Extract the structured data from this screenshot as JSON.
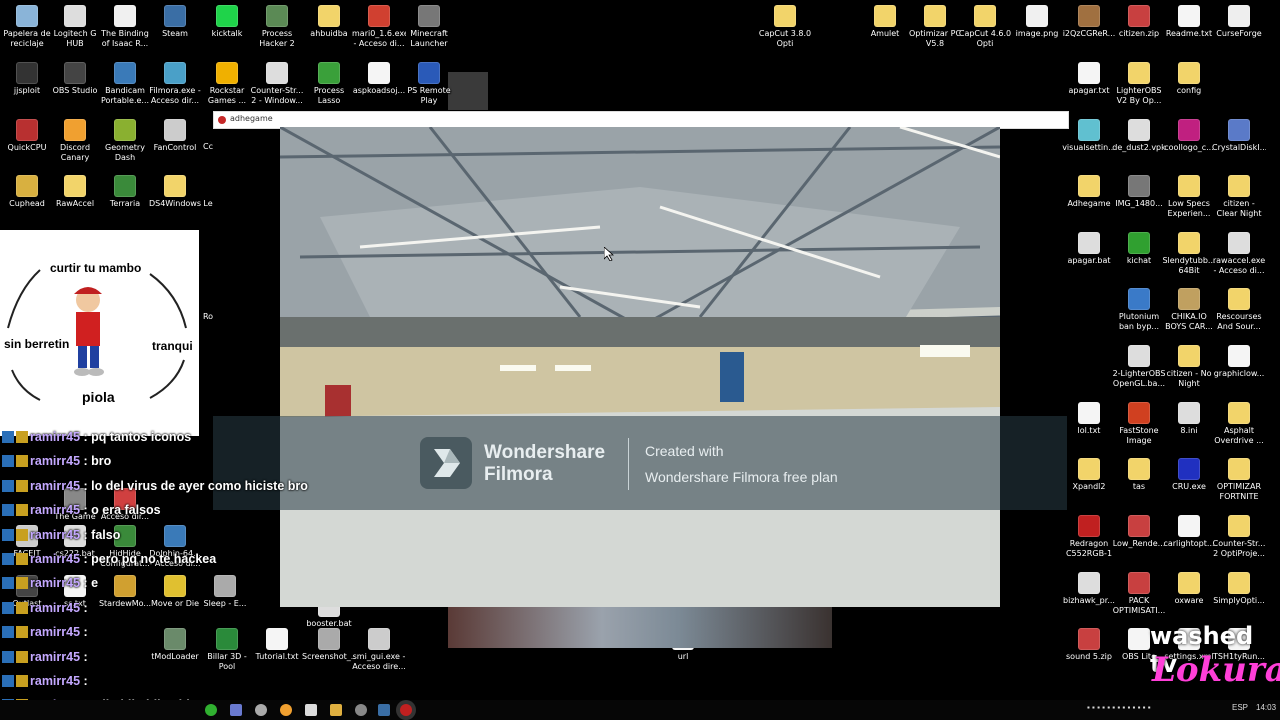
{
  "desktop_left": [
    {
      "label": "Papelera de reciclaje",
      "icon": "recycle-bin-icon",
      "color": "#8ab4d8"
    },
    {
      "label": "Logitech G HUB",
      "icon": "logitech-icon",
      "color": "#dddddd"
    },
    {
      "label": "The Binding of Isaac R...",
      "icon": "isaac-icon",
      "color": "#f0f0f0"
    },
    {
      "label": "Steam",
      "icon": "steam-icon",
      "color": "#3a6ea5"
    },
    {
      "label": "kicktalk",
      "icon": "kicktalk-icon",
      "color": "#1fd34a"
    },
    {
      "label": "Process Hacker 2",
      "icon": "process-hacker-icon",
      "color": "#5b8a55"
    },
    {
      "label": "ahbuidba",
      "icon": "folder-icon",
      "color": "#f2d46a"
    },
    {
      "label": "mari0_1.6.exe - Acceso di...",
      "icon": "mario-icon",
      "color": "#d04030"
    },
    {
      "label": "Minecraft Launcher",
      "icon": "minecraft-icon",
      "color": "#777777"
    },
    {
      "label": "jjsploit",
      "icon": "jjsploit-icon",
      "color": "#333333"
    },
    {
      "label": "OBS Studio",
      "icon": "obs-icon",
      "color": "#444444"
    },
    {
      "label": "Bandicam Portable.e...",
      "icon": "bandicam-icon",
      "color": "#3a7ab8"
    },
    {
      "label": "Filmora.exe - Acceso dir...",
      "icon": "filmora-icon",
      "color": "#4aa0c8"
    },
    {
      "label": "Rockstar Games ...",
      "icon": "rockstar-icon",
      "color": "#f0b000"
    },
    {
      "label": "Counter-Str... 2 - Window...",
      "icon": "cs2-icon",
      "color": "#dddddd"
    },
    {
      "label": "Process Lasso",
      "icon": "process-lasso-icon",
      "color": "#3aa03a"
    },
    {
      "label": "aspkoadsoj...",
      "icon": "file-icon",
      "color": "#f5f5f5"
    },
    {
      "label": "PS Remote Play",
      "icon": "ps-remote-icon",
      "color": "#2a5ab8"
    },
    {
      "label": "QuickCPU",
      "icon": "quickcpu-icon",
      "color": "#b83030"
    },
    {
      "label": "Discord Canary",
      "icon": "discord-icon",
      "color": "#f0a030"
    },
    {
      "label": "Geometry Dash",
      "icon": "geometry-dash-icon",
      "color": "#8ab030"
    },
    {
      "label": "FanControl",
      "icon": "fancontrol-icon",
      "color": "#cccccc"
    },
    {
      "label": "Cuphead",
      "icon": "cuphead-icon",
      "color": "#d8b040"
    },
    {
      "label": "RawAccel",
      "icon": "folder-icon",
      "color": "#f2d46a"
    },
    {
      "label": "Terraria",
      "icon": "terraria-icon",
      "color": "#3a8a3a"
    },
    {
      "label": "DS4Windows",
      "icon": "folder-icon",
      "color": "#f2d46a"
    }
  ],
  "desktop_mid_top": [
    {
      "label": "CapCut 3.8.0 Opti",
      "icon": "folder-icon",
      "color": "#f2d46a"
    },
    {
      "label": "Amulet",
      "icon": "folder-icon",
      "color": "#f2d46a"
    },
    {
      "label": "Optimizar PC V5.8",
      "icon": "folder-icon",
      "color": "#f2d46a"
    },
    {
      "label": "CapCut 4.6.0 Opti",
      "icon": "folder-icon",
      "color": "#f2d46a"
    },
    {
      "label": "image.png",
      "icon": "image-icon",
      "color": "#f0f0f0"
    },
    {
      "label": "i2QzCGReR...",
      "icon": "image-icon",
      "color": "#a07040"
    },
    {
      "label": "citizen.zip",
      "icon": "zip-icon",
      "color": "#c84040"
    },
    {
      "label": "Readme.txt",
      "icon": "text-file-icon",
      "color": "#f5f5f5"
    },
    {
      "label": "CurseForge",
      "icon": "curseforge-icon",
      "color": "#eeeeee"
    }
  ],
  "desktop_right": [
    {
      "label": "apagar.txt",
      "icon": "text-file-icon",
      "color": "#f5f5f5"
    },
    {
      "label": "LighterOBS V2 By Op...",
      "icon": "folder-icon",
      "color": "#f2d46a"
    },
    {
      "label": "config",
      "icon": "folder-icon",
      "color": "#f2d46a"
    },
    {
      "label": "visualsettin...",
      "icon": "file-icon",
      "color": "#60c0d0"
    },
    {
      "label": "de_dust2.vpk",
      "icon": "file-icon",
      "color": "#dddddd"
    },
    {
      "label": "coollogo_c...",
      "icon": "image-icon",
      "color": "#c02080"
    },
    {
      "label": "CrystalDiskI...",
      "icon": "crystaldisk-icon",
      "color": "#5a7ac8"
    },
    {
      "label": "Adhegame",
      "icon": "folder-icon",
      "color": "#f2d46a"
    },
    {
      "label": "IMG_1480...",
      "icon": "image-icon",
      "color": "#777777"
    },
    {
      "label": "Low Specs Experien...",
      "icon": "folder-icon",
      "color": "#f2d46a"
    },
    {
      "label": "citizen - Clear Night",
      "icon": "folder-icon",
      "color": "#f2d46a"
    },
    {
      "label": "apagar.bat",
      "icon": "bat-file-icon",
      "color": "#dddddd"
    },
    {
      "label": "kichat",
      "icon": "kichat-icon",
      "color": "#30a030"
    },
    {
      "label": "Slendytubb... 64Bit",
      "icon": "folder-icon",
      "color": "#f2d46a"
    },
    {
      "label": "rawaccel.exe - Acceso di...",
      "icon": "rawaccel-icon",
      "color": "#dddddd"
    },
    {
      "label": "Plutonium ban byp...",
      "icon": "plutonium-icon",
      "color": "#3a7ac8"
    },
    {
      "label": "CHIKA.IO BOYS CAR...",
      "icon": "image-icon",
      "color": "#c0a060"
    },
    {
      "label": "Rescourses And Sour...",
      "icon": "folder-icon",
      "color": "#f2d46a"
    },
    {
      "label": "2-LighterOBS OpenGL.ba...",
      "icon": "bat-file-icon",
      "color": "#dddddd"
    },
    {
      "label": "citizen - No Night",
      "icon": "folder-icon",
      "color": "#f2d46a"
    },
    {
      "label": "graphiclow...",
      "icon": "file-icon",
      "color": "#f5f5f5"
    },
    {
      "label": "lol.txt",
      "icon": "text-file-icon",
      "color": "#f5f5f5"
    },
    {
      "label": "FastStone Image Viewer",
      "icon": "faststone-icon",
      "color": "#d04020"
    },
    {
      "label": "8.ini",
      "icon": "ini-file-icon",
      "color": "#dddddd"
    },
    {
      "label": "Asphalt Overdrive ...",
      "icon": "folder-icon",
      "color": "#f2d46a"
    },
    {
      "label": "Xpandl2",
      "icon": "folder-icon",
      "color": "#f2d46a"
    },
    {
      "label": "tas",
      "icon": "folder-icon",
      "color": "#f2d46a"
    },
    {
      "label": "CRU.exe",
      "icon": "cru-icon",
      "color": "#2030c0"
    },
    {
      "label": "OPTIMIZAR FORTNITE",
      "icon": "folder-icon",
      "color": "#f2d46a"
    },
    {
      "label": "Redragon C552RGB-1 ...",
      "icon": "redragon-icon",
      "color": "#c02020"
    },
    {
      "label": "Low_Rende...",
      "icon": "zip-icon",
      "color": "#c84040"
    },
    {
      "label": "carlightopt...",
      "icon": "file-icon",
      "color": "#f5f5f5"
    },
    {
      "label": "Counter-Str... 2 OptiProje...",
      "icon": "folder-icon",
      "color": "#f2d46a"
    },
    {
      "label": "bizhawk_pr...",
      "icon": "bizhawk-icon",
      "color": "#dddddd"
    },
    {
      "label": "PACK OPTIMISATI...",
      "icon": "zip-icon",
      "color": "#c84040"
    },
    {
      "label": "oxware",
      "icon": "folder-icon",
      "color": "#f2d46a"
    },
    {
      "label": "SimplyOpti...",
      "icon": "file-icon",
      "color": "#f2d46a"
    },
    {
      "label": "sound 5.zip",
      "icon": "zip-icon",
      "color": "#c84040"
    },
    {
      "label": "OBS Lite",
      "icon": "file-icon",
      "color": "#f5f5f5"
    },
    {
      "label": "settings.xml",
      "icon": "xml-file-icon",
      "color": "#f5f5f5"
    },
    {
      "label": "TSH1tyRun...",
      "icon": "file-icon",
      "color": "#f5f5f5"
    }
  ],
  "desktop_bottom": [
    {
      "label": "The Game",
      "icon": "game-icon",
      "color": "#888888"
    },
    {
      "label": "Acceso dir...",
      "icon": "shortcut-icon",
      "color": "#d04040"
    },
    {
      "label": "FACEIT",
      "icon": "faceit-icon",
      "color": "#cccccc"
    },
    {
      "label": "cs222.bat",
      "icon": "bat-file-icon",
      "color": "#dddddd"
    },
    {
      "label": "HidHide Configurat...",
      "icon": "hidhide-icon",
      "color": "#3a8a3a"
    },
    {
      "label": "Dolphin-64... - Acceso di...",
      "icon": "dolphin-icon",
      "color": "#3a7ab8"
    },
    {
      "label": "Outlast",
      "icon": "outlast-icon",
      "color": "#444444"
    },
    {
      "label": "ss.txt",
      "icon": "text-file-icon",
      "color": "#f5f5f5"
    },
    {
      "label": "StardewMo...",
      "icon": "stardew-icon",
      "color": "#d0a030"
    },
    {
      "label": "Move or Die",
      "icon": "move-or-die-icon",
      "color": "#e0c030"
    },
    {
      "label": "Sleep - E...",
      "icon": "file-icon",
      "color": "#aaaaaa"
    },
    {
      "label": "booster.bat",
      "icon": "bat-file-icon",
      "color": "#dddddd"
    },
    {
      "label": "tModLoader",
      "icon": "tmodloader-icon",
      "color": "#6a8a6a"
    },
    {
      "label": "Billar 3D - Pool",
      "icon": "billar-icon",
      "color": "#2a8a3a"
    },
    {
      "label": "Tutorial.txt",
      "icon": "text-file-icon",
      "color": "#f5f5f5"
    },
    {
      "label": "Screenshot_...",
      "icon": "image-icon",
      "color": "#aaaaaa"
    },
    {
      "label": "smi_gui.exe - Acceso dire...",
      "icon": "smi-gui-icon",
      "color": "#cccccc"
    },
    {
      "label": "url",
      "icon": "file-icon",
      "color": "#f5f5f5"
    }
  ],
  "window": {
    "title": "adhegame"
  },
  "watermark": {
    "brand": "Wondershare\nFilmora",
    "created": "Created with",
    "plan": "Wondershare Filmora free plan"
  },
  "meme": {
    "top": "curtir tu mambo",
    "left": "sin berretin",
    "right": "tranqui",
    "bottom": "piola"
  },
  "chat": [
    {
      "user": "ramirr45",
      "msg": ": pq tantos iconos"
    },
    {
      "user": "ramirr45",
      "msg": ": bro"
    },
    {
      "user": "ramirr45",
      "msg": ": lo del virus de ayer como hiciste bro"
    },
    {
      "user": "ramirr45",
      "msg": ": o era falsos"
    },
    {
      "user": "ramirr45",
      "msg": ": falso"
    },
    {
      "user": "ramirr45",
      "msg": ": pero pq no te hackea"
    },
    {
      "user": "ramirr45",
      "msg": ": e"
    },
    {
      "user": "ramirr45",
      "msg": ":"
    },
    {
      "user": "ramirr45",
      "msg": ":"
    },
    {
      "user": "ramirr45",
      "msg": ":"
    },
    {
      "user": "ramirr45",
      "msg": ":"
    },
    {
      "user": "ramirr45",
      "msg": ": adhajdhajdhasjd"
    }
  ],
  "stream_brand": {
    "name": "washed tv",
    "sub": "Lokura"
  },
  "taskbar": {
    "lang": "ESP",
    "time": "14:03"
  },
  "stray_labels": {
    "cc": "Cc",
    "le": "Le",
    "ro": "Ro"
  }
}
